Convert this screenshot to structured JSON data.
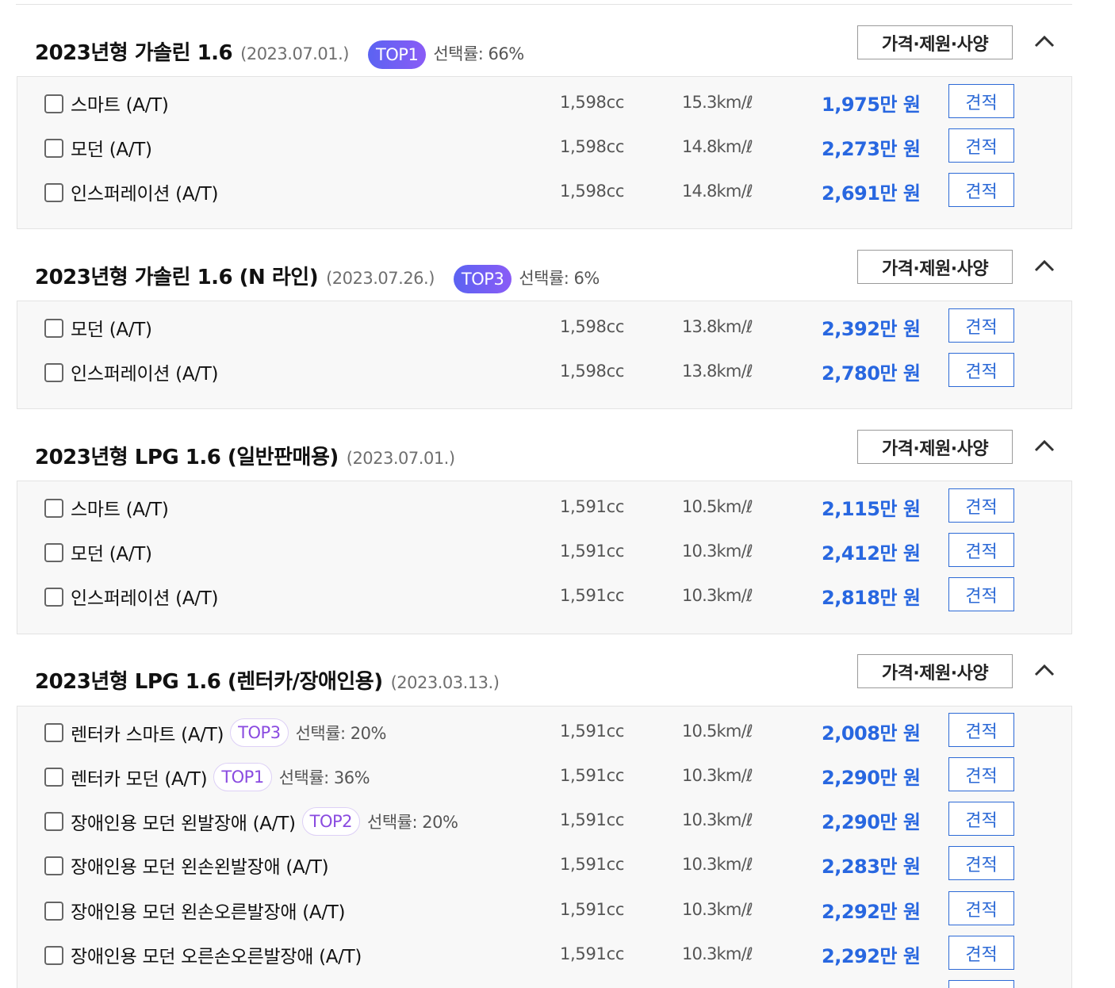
{
  "common": {
    "spec_button": "가격·제원·사양",
    "quote_button": "견적"
  },
  "groups": [
    {
      "name": "2023년형 가솔린 1.6",
      "date": "(2023.07.01.)",
      "badge": "TOP1",
      "rate": "선택률: 66%",
      "trims": [
        {
          "name": "스마트 (A/T)",
          "cc": "1,598cc",
          "efficiency": "15.3km/ℓ",
          "price": "1,975만 원"
        },
        {
          "name": "모던 (A/T)",
          "cc": "1,598cc",
          "efficiency": "14.8km/ℓ",
          "price": "2,273만 원"
        },
        {
          "name": "인스퍼레이션 (A/T)",
          "cc": "1,598cc",
          "efficiency": "14.8km/ℓ",
          "price": "2,691만 원"
        }
      ]
    },
    {
      "name": "2023년형 가솔린 1.6 (N 라인)",
      "date": "(2023.07.26.)",
      "badge": "TOP3",
      "rate": "선택률: 6%",
      "trims": [
        {
          "name": "모던 (A/T)",
          "cc": "1,598cc",
          "efficiency": "13.8km/ℓ",
          "price": "2,392만 원"
        },
        {
          "name": "인스퍼레이션 (A/T)",
          "cc": "1,598cc",
          "efficiency": "13.8km/ℓ",
          "price": "2,780만 원"
        }
      ]
    },
    {
      "name": "2023년형 LPG 1.6 (일반판매용)",
      "date": "(2023.07.01.)",
      "trims": [
        {
          "name": "스마트 (A/T)",
          "cc": "1,591cc",
          "efficiency": "10.5km/ℓ",
          "price": "2,115만 원"
        },
        {
          "name": "모던 (A/T)",
          "cc": "1,591cc",
          "efficiency": "10.3km/ℓ",
          "price": "2,412만 원"
        },
        {
          "name": "인스퍼레이션 (A/T)",
          "cc": "1,591cc",
          "efficiency": "10.3km/ℓ",
          "price": "2,818만 원"
        }
      ]
    },
    {
      "name": "2023년형 LPG 1.6 (렌터카/장애인용)",
      "date": "(2023.03.13.)",
      "trims": [
        {
          "name": "렌터카 스마트 (A/T)",
          "badge": "TOP3",
          "rate": "선택률: 20%",
          "cc": "1,591cc",
          "efficiency": "10.5km/ℓ",
          "price": "2,008만 원"
        },
        {
          "name": "렌터카 모던 (A/T)",
          "badge": "TOP1",
          "rate": "선택률: 36%",
          "cc": "1,591cc",
          "efficiency": "10.3km/ℓ",
          "price": "2,290만 원"
        },
        {
          "name": "장애인용 모던 왼발장애 (A/T)",
          "badge": "TOP2",
          "rate": "선택률: 20%",
          "cc": "1,591cc",
          "efficiency": "10.3km/ℓ",
          "price": "2,290만 원"
        },
        {
          "name": "장애인용 모던 왼손왼발장애 (A/T)",
          "cc": "1,591cc",
          "efficiency": "10.3km/ℓ",
          "price": "2,283만 원"
        },
        {
          "name": "장애인용 모던 왼손오른발장애 (A/T)",
          "cc": "1,591cc",
          "efficiency": "10.3km/ℓ",
          "price": "2,292만 원"
        },
        {
          "name": "장애인용 모던 오른손오른발장애 (A/T)",
          "cc": "1,591cc",
          "efficiency": "10.3km/ℓ",
          "price": "2,292만 원"
        }
      ]
    }
  ]
}
